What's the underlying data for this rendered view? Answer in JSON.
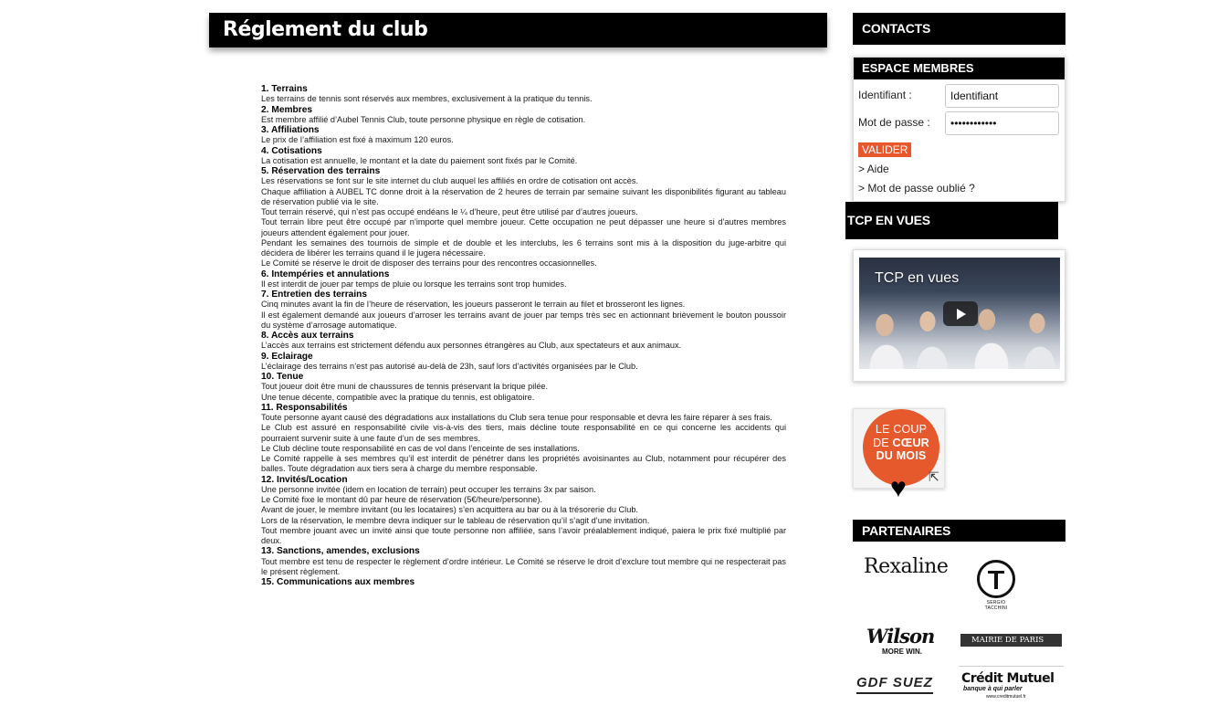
{
  "page": {
    "title": "Réglement du club"
  },
  "rules": [
    {
      "heading": "1. Terrains",
      "paragraphs": [
        "Les terrains de tennis sont réservés aux membres, exclusivement à la pratique du tennis."
      ]
    },
    {
      "heading": "2. Membres",
      "paragraphs": [
        "Est membre affilié d’Aubel Tennis Club, toute personne physique en règle de cotisation."
      ]
    },
    {
      "heading": "3. Affiliations",
      "paragraphs": [
        "Le prix de l’affiliation est fixé à maximum 120 euros."
      ]
    },
    {
      "heading": "4. Cotisations",
      "paragraphs": [
        "La cotisation est annuelle, le montant et la date du paiement sont fixés par le Comité."
      ]
    },
    {
      "heading": "5. Réservation des terrains",
      "paragraphs": [
        "Les réservations se font sur le site internet du club auquel les affiliés en ordre de cotisation ont accès.",
        "Chaque affiliation à AUBEL TC donne droit à la réservation de 2 heures de terrain par semaine suivant les disponibilités figurant au tableau de réservation publié via le site.",
        "Tout terrain réservé, qui n’est pas occupé endéans le ¼ d’heure, peut être utilisé par d’autres joueurs.",
        "Tout terrain libre peut être occupé par n’importe quel membre joueur. Cette occupation ne peut dépasser une heure si d’autres membres joueurs attendent également pour jouer.",
        "Pendant les semaines des tournois de simple et de double et les interclubs, les 6 terrains sont mis à la disposition du juge-arbitre qui décidera de libérer les terrains quand il le jugera nécessaire.",
        "Le Comité se réserve le droit de disposer des terrains pour des rencontres occasionnelles."
      ]
    },
    {
      "heading": "6. Intempéries et annulations",
      "paragraphs": [
        "Il est interdit de jouer par temps de pluie ou lorsque les terrains sont trop humides."
      ]
    },
    {
      "heading": "7. Entretien des terrains",
      "paragraphs": [
        "Cinq minutes avant la fin de l’heure de réservation, les joueurs passeront le terrain au filet et brosseront les lignes.",
        "Il est également demandé aux joueurs d’arroser les terrains avant de jouer par temps très sec en actionnant brièvement le bouton poussoir du système d’arrosage automatique."
      ]
    },
    {
      "heading": "8. Accès aux terrains",
      "paragraphs": [
        "L’accès aux terrains est strictement défendu aux personnes étrangères au Club, aux spectateurs et aux animaux."
      ]
    },
    {
      "heading": "9. Eclairage",
      "paragraphs": [
        "L’éclairage des terrains n’est pas autorisé au-delà de 23h, sauf lors d’activités organisées par le Club."
      ]
    },
    {
      "heading": "10. Tenue",
      "paragraphs": [
        "Tout joueur doit être muni de chaussures de tennis préservant la brique pilée.",
        "Une tenue décente, compatible avec la pratique du tennis, est obligatoire."
      ]
    },
    {
      "heading": "11. Responsabilités",
      "paragraphs": [
        "Toute personne ayant causé des dégradations aux installations du Club sera tenue pour responsable et devra les faire réparer à ses frais.",
        "Le Club est assuré en responsabilité civile vis-à-vis des tiers, mais décline toute responsabilité en ce qui concerne les accidents qui pourraient survenir suite à une faute d’un de ses membres.",
        "Le Club décline toute responsabilité en cas de vol dans l’enceinte de ses installations.",
        "Le Comité rappelle à ses membres qu’il est interdit de pénétrer dans les propriétés avoisinantes au Club, notamment pour récupérer des balles. Toute dégradation aux tiers sera à charge du membre responsable."
      ]
    },
    {
      "heading": "12. Invités/Location",
      "paragraphs": [
        "Une personne invitée (idem en location de terrain) peut occuper les terrains 3x par saison.",
        "Le Comité fixe le montant dû par heure de réservation (5€/heure/personne).",
        "Avant de jouer, le membre invitant (ou les locataires) s’en acquittera au bar ou à la trésorerie du Club.",
        "Lors de la réservation, le membre devra indiquer sur le tableau de réservation qu’il s’agit d’une invitation.",
        "Tout membre jouant avec un invité ainsi que toute personne non affiliée, sans l’avoir préalablement indiqué, paiera le prix fixé multiplié par deux."
      ]
    },
    {
      "heading": "13. Sanctions, amendes, exclusions",
      "paragraphs": [
        "Tout membre est tenu de respecter le règlement d’ordre intérieur. Le Comité se réserve le droit d’exclure tout membre qui ne respecterait pas le présent règlement."
      ]
    },
    {
      "heading": "15. Communications aux membres",
      "paragraphs": []
    }
  ],
  "sidebar": {
    "contacts_label": "CONTACTS",
    "members": {
      "heading": "ESPACE MEMBRES",
      "login_label": "Identifiant :",
      "login_value": "Identifiant",
      "password_label": "Mot de passe :",
      "password_value": "••••••••••••",
      "submit_label": "VALIDER",
      "help_link": "> Aide",
      "forgot_link": "> Mot de passe oublié ?"
    },
    "tcp": {
      "heading": "TCP EN VUES",
      "video_title": "TCP en vues"
    },
    "coup_de_coeur": {
      "line1": "LE COUP",
      "line2a": "DE ",
      "line2b": "CŒUR",
      "line3": "DU MOIS"
    },
    "partners": {
      "heading": "PARTENAIRES",
      "rexaline": "Rexaline",
      "tacchini": "SERGIO TACCHINI",
      "wilson": "Wilson",
      "wilson_tagline": "MORE WIN.",
      "mairie": "MAIRIE DE PARIS",
      "gdf": "GDF SUEZ",
      "credit": "Crédit Mutuel",
      "credit_tagline": "banque à qui parler",
      "credit_url": "www.creditmutuel.fr"
    }
  }
}
